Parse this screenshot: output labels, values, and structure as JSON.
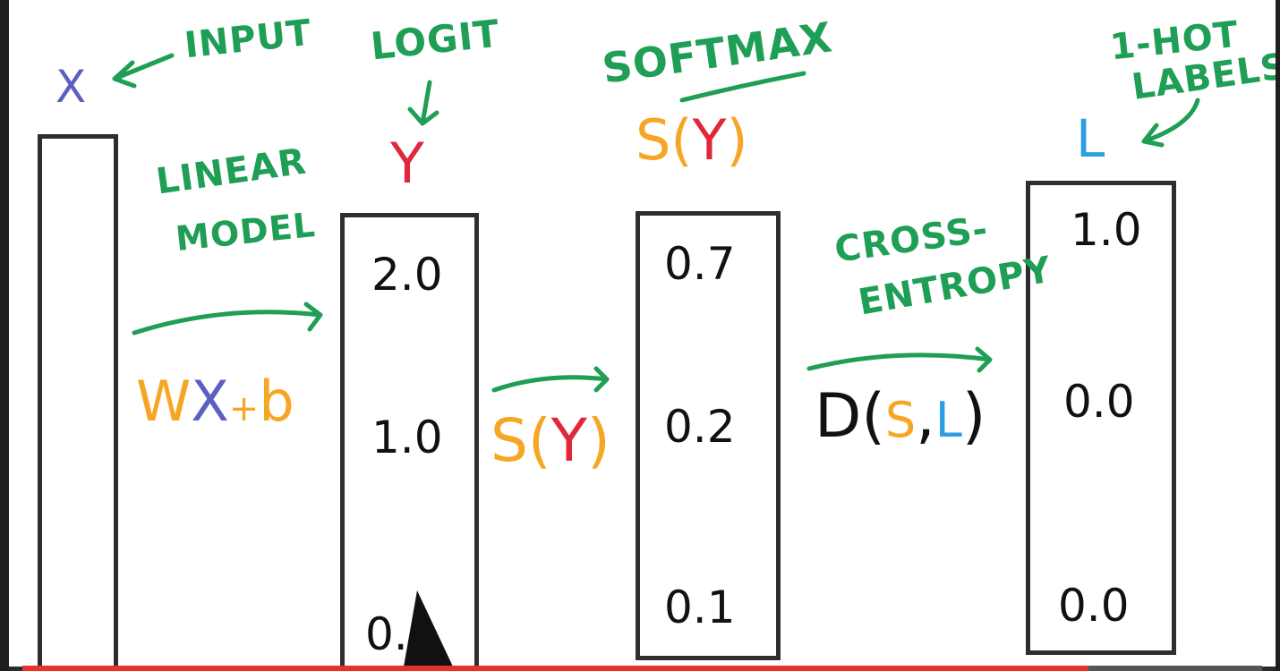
{
  "labels": {
    "x_var": "X",
    "input": "INPUT",
    "linear": "LINEAR",
    "model": "MODEL",
    "eq_w": "W",
    "eq_x": "X",
    "eq_plus": "+",
    "eq_b": "b",
    "logit": "LOGIT",
    "y_var": "Y",
    "softmax": "SOFTMAX",
    "s_head_s": "S(",
    "s_head_y": "Y",
    "s_head_close": ")",
    "s_mid_s": "S(",
    "s_mid_y": "Y",
    "s_mid_close": ")",
    "cross": "CROSS-",
    "entropy": "ENTROPY",
    "d_open": "D(",
    "d_s": "S",
    "d_comma": ",",
    "d_l": "L",
    "d_close": ")",
    "one_hot": "1-HOT",
    "labels_word": "LABELS",
    "l_var": "L"
  },
  "logits": [
    "2.0",
    "1.0",
    "0."
  ],
  "softmax_values": [
    "0.7",
    "0.2",
    "0.1"
  ],
  "one_hot_values": [
    "1.0",
    "0.0",
    "0.0"
  ],
  "colors": {
    "green": "#1f9e55",
    "orange": "#f5a623",
    "red": "#e0283c",
    "blue_purple": "#5a5fc2",
    "blue": "#2d9ee0",
    "ink": "#111111"
  },
  "player": {
    "progress": 0.86
  }
}
